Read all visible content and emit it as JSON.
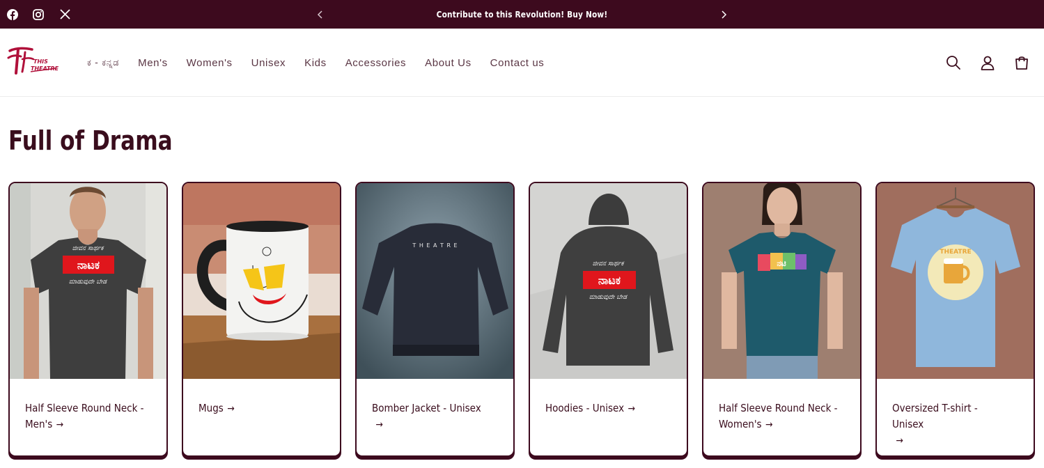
{
  "announcement": {
    "message": "Contribute to this Revolution! Buy Now!",
    "social": [
      "facebook-icon",
      "instagram-icon",
      "x-icon"
    ],
    "bg_color": "#3d0a1e"
  },
  "header": {
    "logo_text": "THIS IS THEATRE",
    "nav": [
      {
        "label": "ಕ - ಕನ್ನಡ"
      },
      {
        "label": "Men's"
      },
      {
        "label": "Women's"
      },
      {
        "label": "Unisex"
      },
      {
        "label": "Kids"
      },
      {
        "label": "Accessories"
      },
      {
        "label": "About Us"
      },
      {
        "label": "Contact us"
      }
    ],
    "icons": [
      "search-icon",
      "account-icon",
      "cart-icon"
    ]
  },
  "section": {
    "title": "Full of Drama"
  },
  "cards": [
    {
      "title": "Half Sleeve Round Neck - Men's"
    },
    {
      "title": "Mugs"
    },
    {
      "title": "Bomber Jacket - Unisex"
    },
    {
      "title": "Hoodies - Unisex"
    },
    {
      "title": "Half Sleeve Round Neck - Women's"
    },
    {
      "title": "Oversized T-shirt - Unisex"
    }
  ],
  "artwork_text": {
    "natak": "ನಾಟಕ",
    "jacket_print": "T H E A T R E",
    "oversized_badge": "THEATRE"
  },
  "colors": {
    "accent": "#3d0a1e",
    "text": "#3a0d1d",
    "nav_text": "#5a3644"
  }
}
